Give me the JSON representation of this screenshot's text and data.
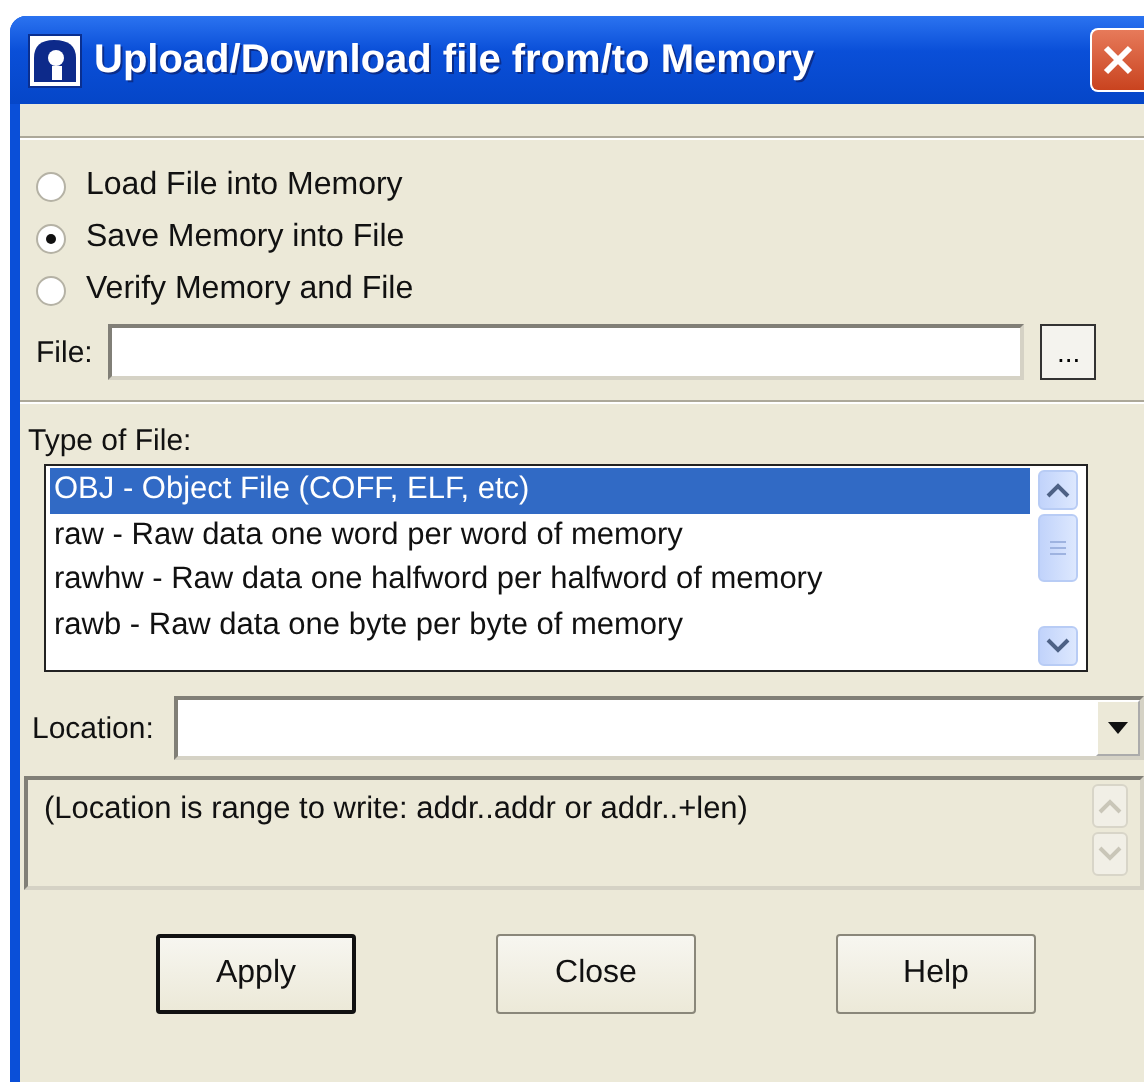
{
  "window": {
    "title": "Upload/Download file from/to Memory"
  },
  "modes": [
    {
      "label": "Load File into Memory",
      "selected": false
    },
    {
      "label": "Save Memory into File",
      "selected": true
    },
    {
      "label": "Verify Memory and File",
      "selected": false
    }
  ],
  "file": {
    "label": "File:",
    "browse": "..."
  },
  "file_type": {
    "label": "Type of File:",
    "items": [
      {
        "label": "OBJ - Object File (COFF, ELF, etc)",
        "selected": true
      },
      {
        "label": "raw - Raw data one word per word of memory",
        "selected": false
      },
      {
        "label": "rawhw - Raw data one halfword per halfword of memory",
        "selected": false
      },
      {
        "label": "rawb - Raw data one byte per byte of memory",
        "selected": false
      }
    ]
  },
  "location": {
    "label": "Location:"
  },
  "message": "(Location is range to write: addr..addr or addr..+len)",
  "buttons": [
    {
      "label": "Apply",
      "default": true
    },
    {
      "label": "Close",
      "default": false
    },
    {
      "label": "Help",
      "default": false
    }
  ]
}
